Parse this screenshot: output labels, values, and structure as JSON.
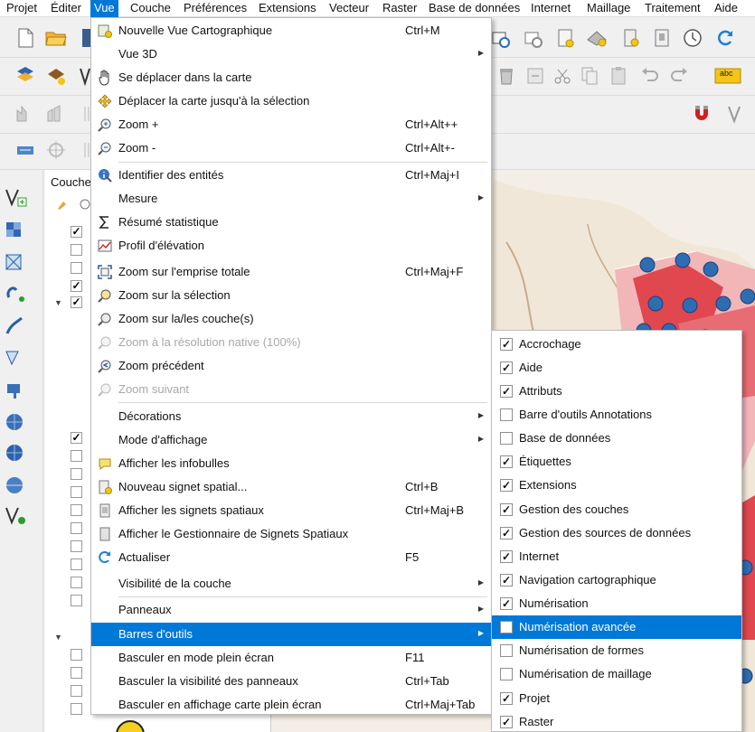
{
  "menubar": {
    "items": [
      {
        "label": "Projet"
      },
      {
        "label": "Éditer"
      },
      {
        "label": "Vue"
      },
      {
        "label": "Couche"
      },
      {
        "label": "Préférences"
      },
      {
        "label": "Extensions"
      },
      {
        "label": "Vecteur"
      },
      {
        "label": "Raster"
      },
      {
        "label": "Base de données"
      },
      {
        "label": "Internet"
      },
      {
        "label": "Maillage"
      },
      {
        "label": "Traitement"
      },
      {
        "label": "Aide"
      }
    ]
  },
  "layers_panel": {
    "title": "Couche"
  },
  "toolbar_icons": {
    "abc_label": "abc"
  },
  "vue_menu": {
    "items": [
      {
        "label": "Nouvelle Vue Cartographique",
        "shortcut": "Ctrl+M",
        "icon": "new-map-view-icon"
      },
      {
        "label": "Vue 3D",
        "shortcut": "",
        "icon": ""
      },
      {
        "label": "Se déplacer dans la carte",
        "shortcut": "",
        "icon": "pan-hand-icon"
      },
      {
        "label": "Déplacer la carte jusqu'à la sélection",
        "shortcut": "",
        "icon": "pan-to-selection-icon"
      },
      {
        "label": "Zoom +",
        "shortcut": "Ctrl+Alt++",
        "icon": "zoom-in-icon"
      },
      {
        "label": "Zoom -",
        "shortcut": "Ctrl+Alt+-",
        "icon": "zoom-out-icon"
      },
      {
        "label": "Identifier des entités",
        "shortcut": "Ctrl+Maj+I",
        "icon": "identify-icon"
      },
      {
        "label": "Mesure",
        "shortcut": "",
        "icon": ""
      },
      {
        "label": "Résumé statistique",
        "shortcut": "",
        "icon": "sigma-icon"
      },
      {
        "label": "Profil d'élévation",
        "shortcut": "",
        "icon": "elevation-profile-icon"
      },
      {
        "label": "Zoom sur l'emprise totale",
        "shortcut": "Ctrl+Maj+F",
        "icon": "zoom-full-icon"
      },
      {
        "label": "Zoom sur la sélection",
        "shortcut": "",
        "icon": "zoom-selection-icon"
      },
      {
        "label": "Zoom sur la/les couche(s)",
        "shortcut": "",
        "icon": "zoom-layer-icon"
      },
      {
        "label": "Zoom à la résolution native (100%)",
        "shortcut": "",
        "icon": "zoom-native-icon"
      },
      {
        "label": "Zoom précédent",
        "shortcut": "",
        "icon": "zoom-last-icon"
      },
      {
        "label": "Zoom suivant",
        "shortcut": "",
        "icon": "zoom-next-icon"
      },
      {
        "label": "Décorations",
        "shortcut": "",
        "icon": ""
      },
      {
        "label": "Mode d'affichage",
        "shortcut": "",
        "icon": ""
      },
      {
        "label": "Afficher les infobulles",
        "shortcut": "",
        "icon": "map-tips-icon"
      },
      {
        "label": "Nouveau signet spatial...",
        "shortcut": "Ctrl+B",
        "icon": "new-bookmark-icon"
      },
      {
        "label": "Afficher les signets spatiaux",
        "shortcut": "Ctrl+Maj+B",
        "icon": "show-bookmarks-icon"
      },
      {
        "label": "Afficher le Gestionnaire de Signets Spatiaux",
        "shortcut": "",
        "icon": "bookmark-manager-icon"
      },
      {
        "label": "Actualiser",
        "shortcut": "F5",
        "icon": "refresh-icon"
      },
      {
        "label": "Visibilité de la couche",
        "shortcut": "",
        "icon": ""
      },
      {
        "label": "Panneaux",
        "shortcut": "",
        "icon": ""
      },
      {
        "label": "Barres d'outils",
        "shortcut": "",
        "icon": ""
      },
      {
        "label": "Basculer en mode plein écran",
        "shortcut": "F11",
        "icon": ""
      },
      {
        "label": "Basculer la visibilité des panneaux",
        "shortcut": "Ctrl+Tab",
        "icon": ""
      },
      {
        "label": "Basculer en affichage carte plein écran",
        "shortcut": "Ctrl+Maj+Tab",
        "icon": ""
      }
    ]
  },
  "toolbars_submenu": {
    "items": [
      {
        "label": "Accrochage",
        "checked": true
      },
      {
        "label": "Aide",
        "checked": true
      },
      {
        "label": "Attributs",
        "checked": true
      },
      {
        "label": "Barre d'outils Annotations",
        "checked": false
      },
      {
        "label": "Base de données",
        "checked": false
      },
      {
        "label": "Étiquettes",
        "checked": true
      },
      {
        "label": "Extensions",
        "checked": true
      },
      {
        "label": "Gestion des couches",
        "checked": true
      },
      {
        "label": "Gestion des sources de données",
        "checked": true
      },
      {
        "label": "Internet",
        "checked": true
      },
      {
        "label": "Navigation cartographique",
        "checked": true
      },
      {
        "label": "Numérisation",
        "checked": true
      },
      {
        "label": "Numérisation avancée",
        "checked": false
      },
      {
        "label": "Numérisation de formes",
        "checked": false
      },
      {
        "label": "Numérisation de maillage",
        "checked": false
      },
      {
        "label": "Projet",
        "checked": true
      },
      {
        "label": "Raster",
        "checked": true
      }
    ]
  },
  "colors": {
    "highlight": "#0078d7",
    "map_blue_point": "#2f6db3",
    "map_red": "#e0474f",
    "map_pink": "#f2b6b8"
  }
}
